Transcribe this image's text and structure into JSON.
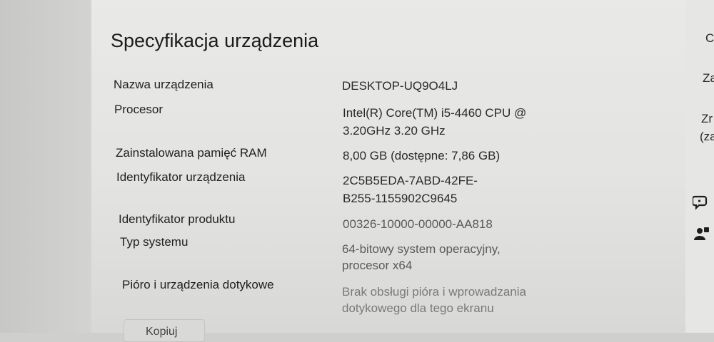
{
  "section": {
    "title": "Specyfikacja urządzenia"
  },
  "specs": [
    {
      "label": "Nazwa urządzenia",
      "value_lines": [
        "DESKTOP-UQ9O4LJ"
      ]
    },
    {
      "label": "Procesor",
      "value_lines": [
        "Intel(R) Core(TM) i5-4460  CPU @",
        "3.20GHz   3.20 GHz"
      ]
    },
    {
      "label": "Zainstalowana pamięć RAM",
      "value_lines": [
        "8,00 GB (dostępne: 7,86 GB)"
      ]
    },
    {
      "label": "Identyfikator urządzenia",
      "value_lines": [
        "2C5B5EDA-7ABD-42FE-",
        "B255-1155902C9645"
      ]
    },
    {
      "label": "Identyfikator produktu",
      "value_lines": [
        "00326-10000-00000-AA818"
      ]
    },
    {
      "label": "Typ systemu",
      "value_lines": [
        "64-bitowy system operacyjny,",
        "procesor x64"
      ]
    },
    {
      "label": "Pióro i urządzenia dotykowe",
      "value_lines": [
        "Brak obsługi pióra i wprowadzania",
        "dotykowego dla tego ekranu"
      ]
    }
  ],
  "copy_button": {
    "label": "Kopiuj"
  },
  "right_strip": {
    "items": [
      "C",
      "Za",
      "Zr",
      "(za"
    ],
    "icons": [
      "help-chat-icon",
      "feedback-person-icon"
    ]
  }
}
